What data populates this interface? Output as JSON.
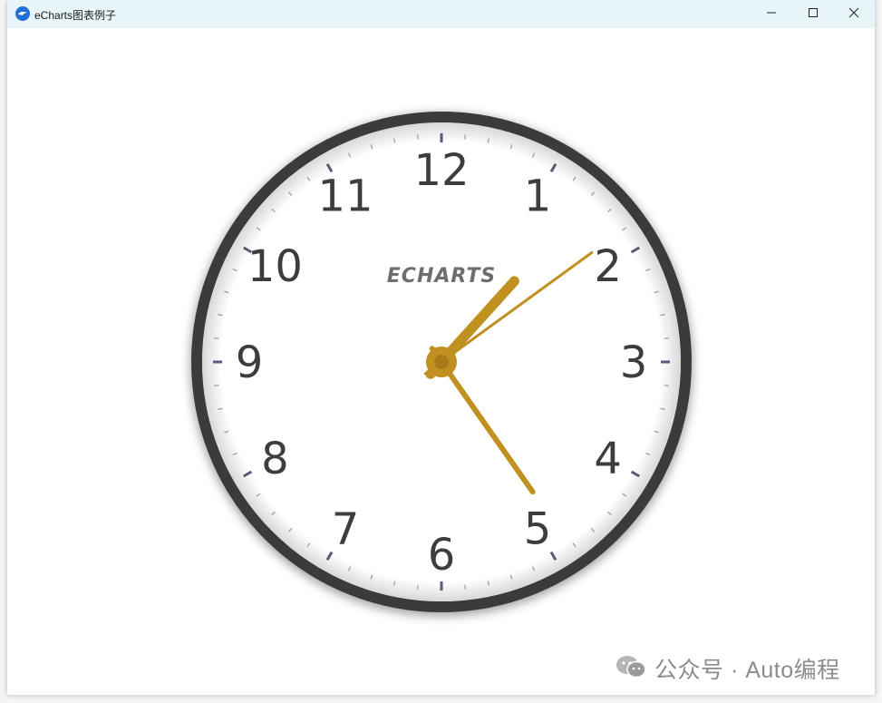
{
  "window": {
    "title": "eCharts图表例子",
    "icon": "echarts-logo-icon",
    "controls": [
      "minimize-icon",
      "maximize-icon",
      "close-icon"
    ]
  },
  "clock": {
    "logo_text": "ECHARTS",
    "hour_labels": [
      "12",
      "1",
      "2",
      "3",
      "4",
      "5",
      "6",
      "7",
      "8",
      "9",
      "10",
      "11"
    ],
    "time": {
      "hour": 1,
      "minute": 24,
      "second": 9
    },
    "colors": {
      "rim": "#3a3a3a",
      "face": "#ffffff",
      "numerals": "#3d3d3d",
      "hands": "#c09020",
      "ticks_major": "#5a5a78",
      "ticks_minor": "#999999",
      "logo": "#6e6e6e"
    }
  },
  "watermark": {
    "icon": "wechat-icon",
    "text": "公众号 · Auto编程"
  }
}
